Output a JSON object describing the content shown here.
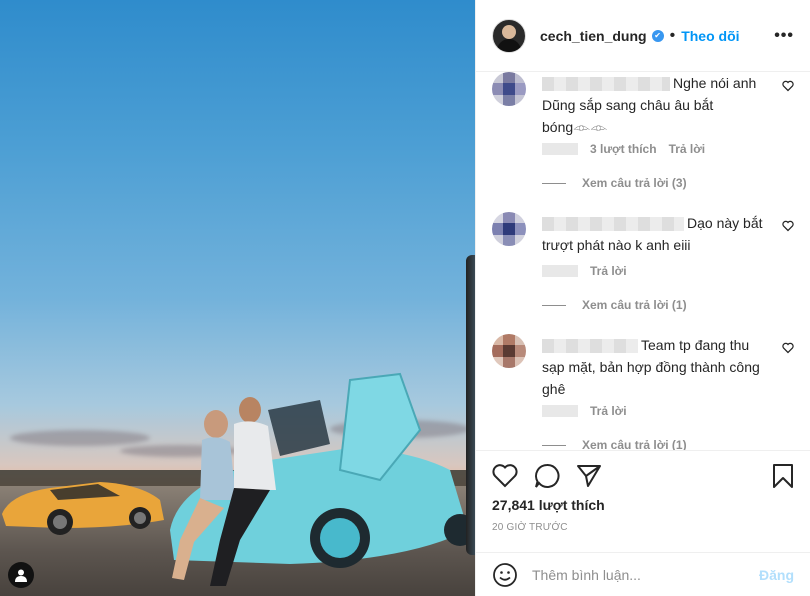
{
  "post": {
    "username": "cech_tien_dung",
    "verified_mark": "✔",
    "separator": "•",
    "follow_label": "Theo dõi",
    "more_label": "•••"
  },
  "comments": [
    {
      "text": "Nghe nói anh Dũng sắp sang châu âu bắt bóng𓁹𓁹",
      "likes_label": "3 lượt thích",
      "reply_label": "Trả lời",
      "view_replies": "Xem câu trả lời (3)",
      "avatar_colors": [
        "#c9c9d6",
        "#7a7aa0",
        "#bdbdd0",
        "#8c8cb4",
        "#3e4a8a",
        "#9a9ac2",
        "#d0d0dc",
        "#7b7fa6",
        "#c4c4d4"
      ]
    },
    {
      "text": "Dạo này bắt trượt phát nào k anh eiii",
      "reply_label": "Trả lời",
      "view_replies": "Xem câu trả lời (1)",
      "avatar_colors": [
        "#d6d6e2",
        "#8a8ab4",
        "#d0d0de",
        "#7c80b0",
        "#2e3a7a",
        "#8c90bc",
        "#cfcfdc",
        "#8a8eb6",
        "#d2d2de"
      ]
    },
    {
      "text": "Team tp đang thu sạp mặt, bản hợp đồng thành công ghê",
      "reply_label": "Trả lời",
      "view_replies": "Xem câu trả lời (1)",
      "avatar_colors": [
        "#d9b8a6",
        "#b07a66",
        "#d8c0b4",
        "#a46c5c",
        "#5a3a32",
        "#b88a7a",
        "#e0c8bc",
        "#a8786a",
        "#dcc2b6"
      ]
    }
  ],
  "stats": {
    "likes": "27,841 lượt thích",
    "time_ago": "20 GIỜ TRƯỚC"
  },
  "comment_box": {
    "placeholder": "Thêm bình luận...",
    "post_label": "Đăng"
  },
  "icons": [
    "heart-icon",
    "comment-icon",
    "share-icon",
    "bookmark-icon",
    "emoji-icon",
    "user-tag-icon"
  ],
  "colors": {
    "accent": "#0095f6",
    "text": "#262626",
    "muted": "#8e8e8e"
  }
}
